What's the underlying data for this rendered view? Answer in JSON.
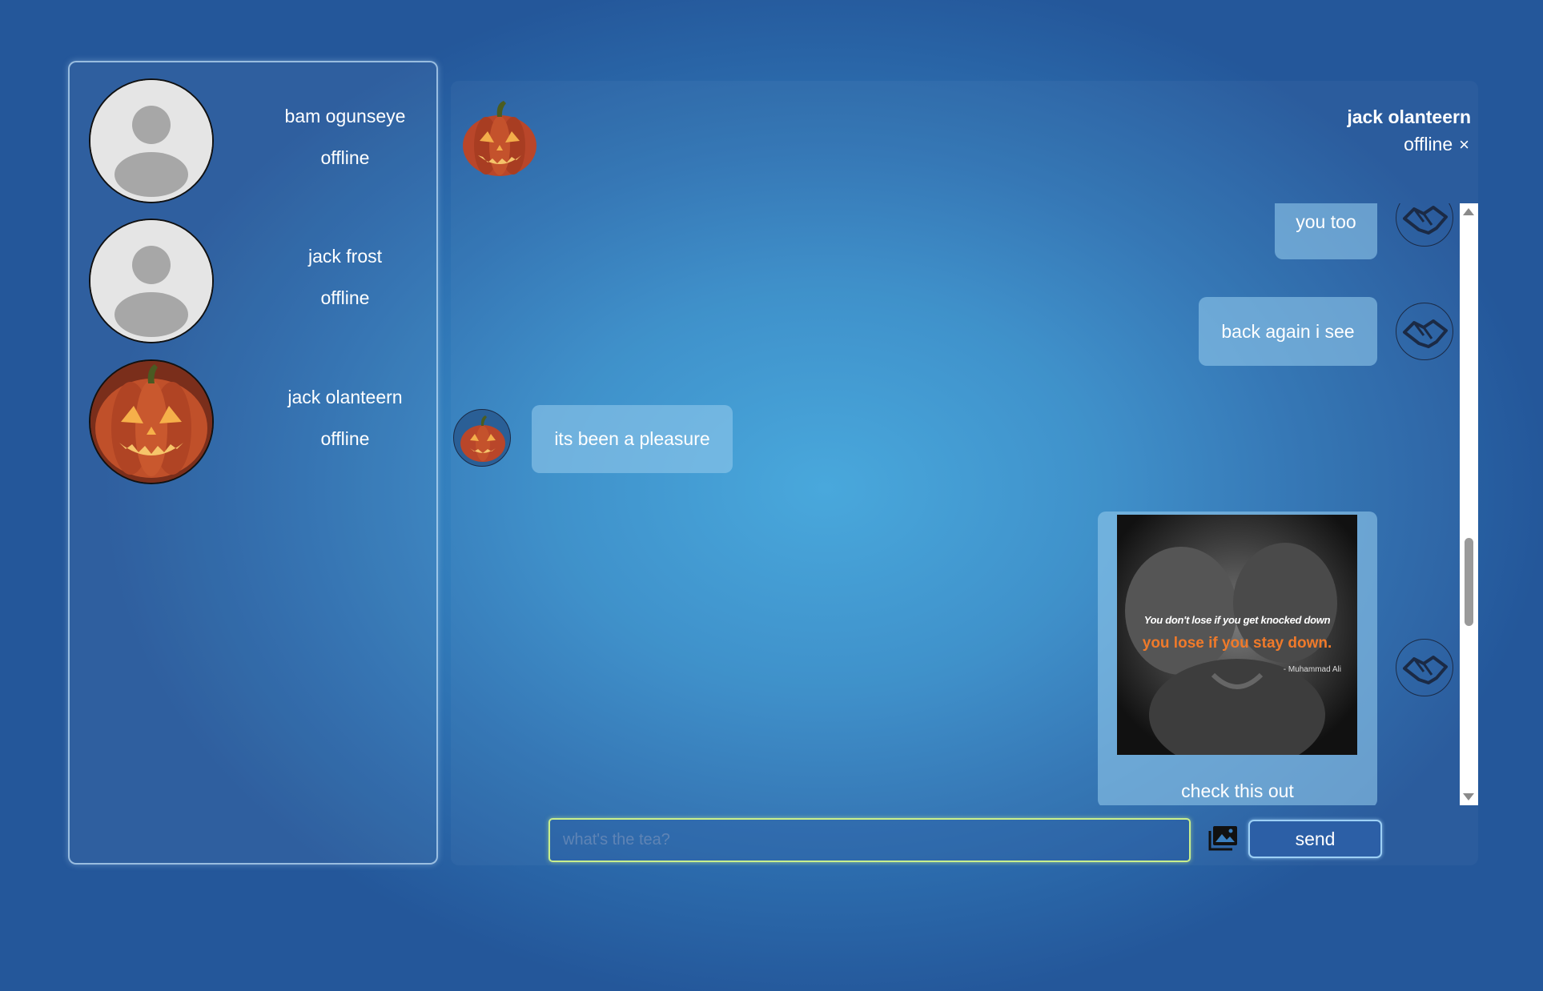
{
  "contacts": [
    {
      "name": "bam ogunseye",
      "status": "offline",
      "avatar": "default-user-icon"
    },
    {
      "name": "jack frost",
      "status": "offline",
      "avatar": "default-user-icon"
    },
    {
      "name": "jack olanteern",
      "status": "offline",
      "avatar": "pumpkin-icon"
    }
  ],
  "chat": {
    "title": "jack olanteern",
    "status": "offline",
    "close_icon": "×",
    "header_avatar": "pumpkin-icon"
  },
  "messages": [
    {
      "from": "me",
      "text": "you too",
      "avatar": "handshake-icon"
    },
    {
      "from": "me",
      "text": "back again i see",
      "avatar": "handshake-icon"
    },
    {
      "from": "them",
      "text": "its been a pleasure",
      "avatar": "pumpkin-icon"
    },
    {
      "from": "me",
      "text": "check this out",
      "avatar": "handshake-icon",
      "image": {
        "line1": "You don't lose if you get knocked down",
        "line2": "you lose if you stay down.",
        "attribution": "- Muhammad Ali"
      }
    }
  ],
  "composer": {
    "placeholder": "what's the tea?",
    "value": "",
    "image_button_icon": "photo-library-icon",
    "send_label": "send"
  },
  "colors": {
    "bubble": "#91c8eb",
    "send_button": "#2c5fa6",
    "input_border": "#c9ef8c"
  }
}
